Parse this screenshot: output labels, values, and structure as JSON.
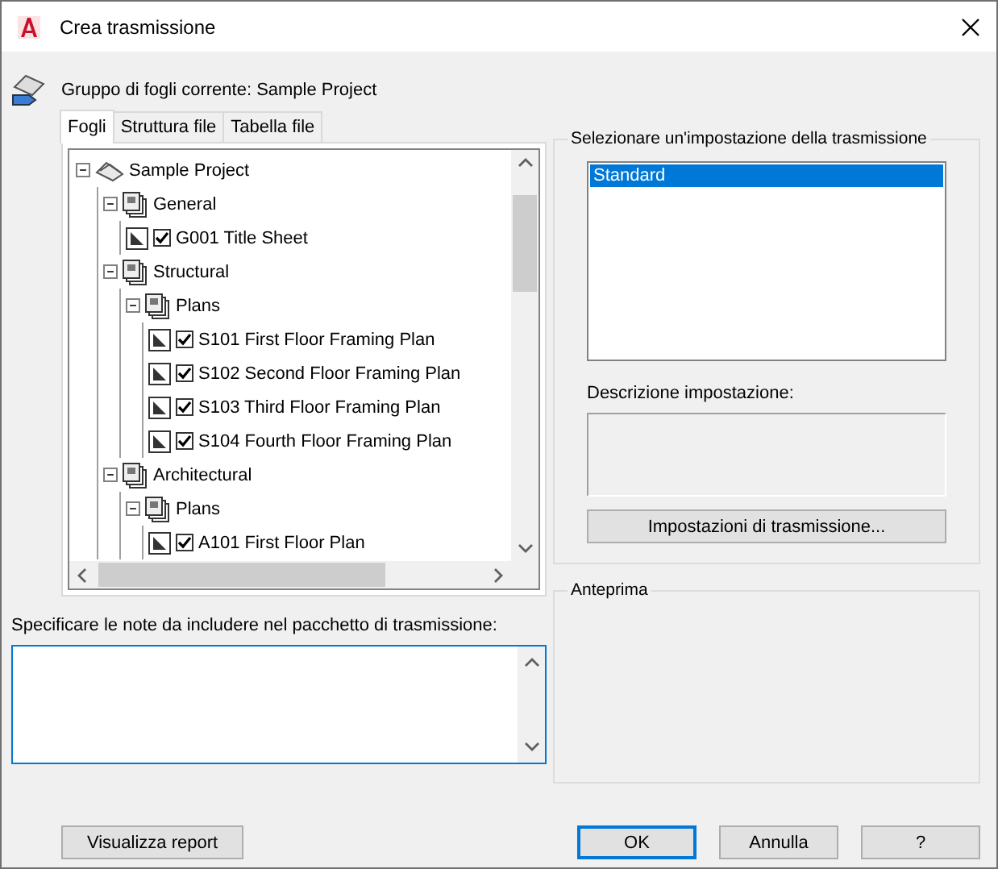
{
  "window": {
    "title": "Crea trasmissione"
  },
  "sheet_set": {
    "label": "Gruppo di fogli corrente: Sample Project"
  },
  "tabs": [
    {
      "label": "Fogli",
      "selected": true
    },
    {
      "label": "Struttura file",
      "selected": false
    },
    {
      "label": "Tabella file",
      "selected": false
    }
  ],
  "tree": [
    {
      "kind": "project",
      "label": "Sample Project",
      "expanded": true,
      "children": [
        {
          "kind": "group",
          "label": "General",
          "expanded": true,
          "children": [
            {
              "kind": "sheet",
              "label": "G001 Title Sheet",
              "checked": true
            }
          ]
        },
        {
          "kind": "group",
          "label": "Structural",
          "expanded": true,
          "children": [
            {
              "kind": "group",
              "label": "Plans",
              "expanded": true,
              "children": [
                {
                  "kind": "sheet",
                  "label": "S101 First Floor Framing Plan",
                  "checked": true
                },
                {
                  "kind": "sheet",
                  "label": "S102 Second Floor Framing Plan",
                  "checked": true
                },
                {
                  "kind": "sheet",
                  "label": "S103 Third Floor Framing Plan",
                  "checked": true
                },
                {
                  "kind": "sheet",
                  "label": "S104 Fourth Floor Framing Plan",
                  "checked": true
                }
              ]
            }
          ]
        },
        {
          "kind": "group",
          "label": "Architectural",
          "expanded": true,
          "children": [
            {
              "kind": "group",
              "label": "Plans",
              "expanded": true,
              "children": [
                {
                  "kind": "sheet",
                  "label": "A101 First Floor Plan",
                  "checked": true
                }
              ]
            }
          ]
        }
      ]
    }
  ],
  "notes": {
    "label": "Specificare le note da includere nel pacchetto di trasmissione:"
  },
  "setup_group": {
    "title": "Selezionare un'impostazione della trasmissione",
    "setups": [
      {
        "label": "Standard",
        "selected": true
      }
    ],
    "description_label": "Descrizione impostazione:",
    "button": "Impostazioni di trasmissione..."
  },
  "preview_group": {
    "title": "Anteprima"
  },
  "buttons": [
    {
      "label": "Visualizza report",
      "kind": "left",
      "default": false
    },
    {
      "label": "OK",
      "kind": "right",
      "default": true
    },
    {
      "label": "Annulla",
      "kind": "right",
      "default": false
    },
    {
      "label": "?",
      "kind": "right",
      "default": false
    }
  ]
}
